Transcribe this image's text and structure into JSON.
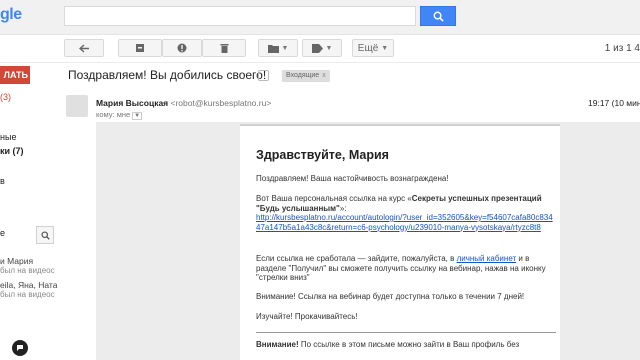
{
  "header": {
    "logo_text": "gle",
    "search_value": ""
  },
  "toolbar": {
    "more_label": "Ещё",
    "pager_range": "1 из 1 4"
  },
  "compose": {
    "label": "ЛАТЬ"
  },
  "sidebar": {
    "inbox_count": "(3)",
    "item_starred": "ные",
    "item_drafts": "ки (7)",
    "item_b": "в",
    "item_e": "е",
    "contacts": [
      {
        "name": "и Мария",
        "status": "был на видеос"
      },
      {
        "name": "eila, Яна, Ната",
        "status": "был на видеос"
      }
    ]
  },
  "email": {
    "subject": "Поздравляем! Вы добились своего!",
    "label": "Входящие",
    "label_close": "x",
    "sender_name": "Мария Высоцкая",
    "sender_email": "<robot@kursbesplatno.ru>",
    "to_me": "кому: мне",
    "time": "19:17 (10 мин",
    "body": {
      "greeting": "Здравствуйте, Мария",
      "p1": "Поздравляем! Ваша настойчивость вознаграждена!",
      "p2_prefix": "Вот Ваша персональная ссылка на курс «",
      "p2_course": "Секреты успешных презентаций \"Будь услышанным\"",
      "p2_suffix": "»:",
      "p2_link": "http://kursbesplatno.ru/account/autologin/?user_id=352605&key=f54607cafa80c83447a147b5a1a43c8c&return=c6-psychology/u239010-manya-vysotskaya/rtyzc8t8",
      "p3_prefix": "Если ссылка не сработала — зайдите, пожалуйста, в ",
      "p3_link": "личный кабинет",
      "p3_suffix": " и в разделе \"Получил\" вы сможете получить ссылку на вебинар, нажав на иконку \"стрелки вниз\"",
      "p4": "Внимание! Ссылка на вебинар будет доступна только в течении 7 дней!",
      "p5": "Изучайте! Прокачивайтесь!",
      "p6_bold": "Внимание!",
      "p6_rest": " По ссылке в этом письме можно зайти в Ваш профиль без"
    }
  }
}
